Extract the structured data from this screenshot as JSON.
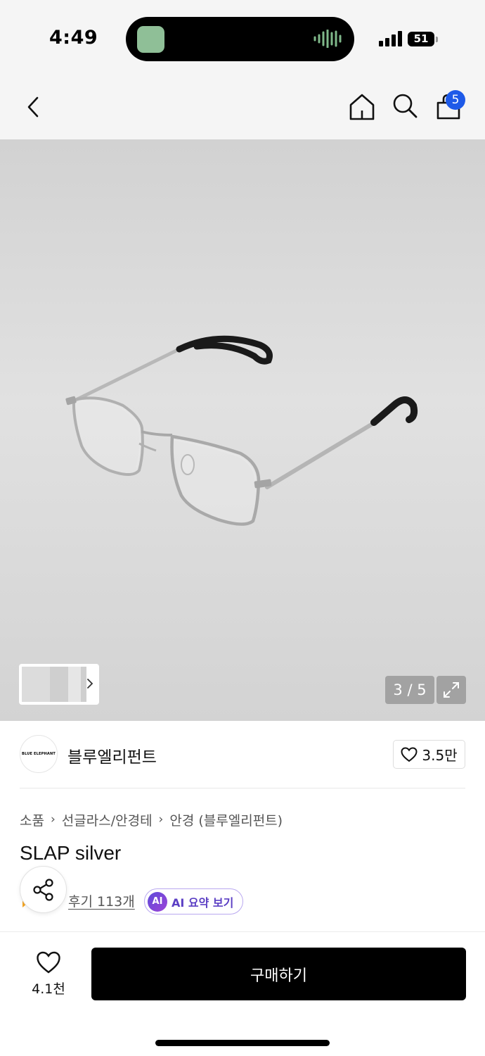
{
  "status_bar": {
    "time": "4:49",
    "battery": "51"
  },
  "nav": {
    "cart_count": "5",
    "icons": [
      "chevron-left-icon",
      "home-icon",
      "search-icon",
      "shopping-bag-icon"
    ]
  },
  "gallery": {
    "page_counter": "3 / 5",
    "current": 3,
    "total": 5
  },
  "brand": {
    "logo_text": "BLUE ELEPHANT",
    "name": "블루엘리펀트",
    "like_count": "3.5만"
  },
  "product": {
    "breadcrumb": [
      "소품",
      "선글라스/안경테",
      "안경 (블루엘리펀트)"
    ],
    "title": "SLAP silver",
    "review_link": "후기 113개",
    "ai_badge": "AI",
    "ai_summary": "AI 요약 보기"
  },
  "bottom_bar": {
    "like_count": "4.1천",
    "buy_label": "구매하기"
  },
  "colors": {
    "header_bg": "#f5f5f5",
    "badge_blue": "#1e5ae8",
    "ai_purple": "#5b3fc4",
    "buy_button": "#000000"
  }
}
